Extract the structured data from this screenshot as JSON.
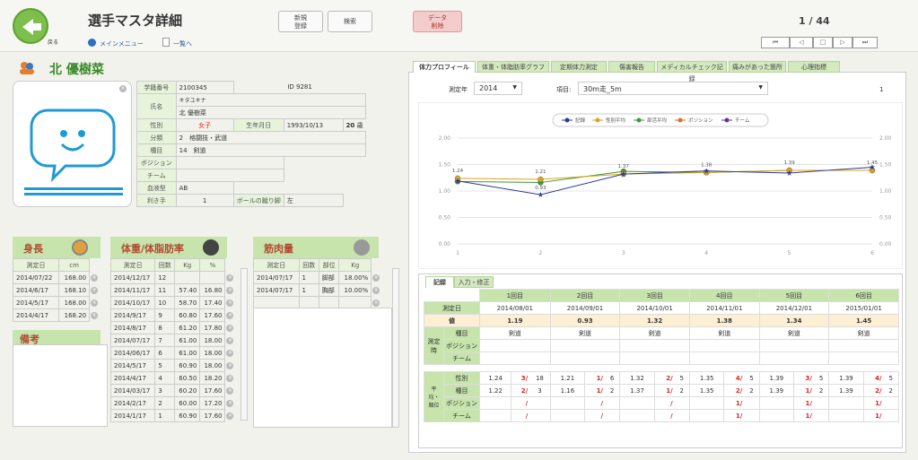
{
  "header": {
    "back_label": "戻る",
    "title": "選手マスタ詳細",
    "menu_link": "メインメニュー",
    "list_link": "一覧へ",
    "new_label": "新規\n登録",
    "search_label": "検索",
    "delete_label": "データ\n削除",
    "record_counter": "1 / 44"
  },
  "athlete": {
    "name": "北 優樹菜",
    "fields": {
      "student_no_label": "学籍番号",
      "student_no": "2100345",
      "id": "ID 9281",
      "name_label": "氏名",
      "kana": "キタユキナ",
      "name": "北 優樹菜",
      "gender_label": "性別",
      "gender": "女子",
      "birth_label": "生年月日",
      "birth": "1993/10/13",
      "age": "20",
      "age_unit": "歳",
      "class_label": "分類",
      "class_no": "2",
      "class_name": "格闘技・武道",
      "event_label": "種目",
      "event_no": "14",
      "event_name": "剣道",
      "position_label": "ポジション",
      "team_label": "チーム",
      "blood_label": "血液型",
      "blood": "AB",
      "hand_label": "利き手",
      "hand": "1",
      "foot_label": "ボールの蹴り脚",
      "foot": "左"
    }
  },
  "height": {
    "title": "身長",
    "col_date": "測定日",
    "col_unit": "cm",
    "rows": [
      [
        "2014/07/22",
        "168.00"
      ],
      [
        "2014/6/17",
        "168.10"
      ],
      [
        "2014/5/17",
        "168.00"
      ],
      [
        "2014/4/17",
        "168.20"
      ]
    ]
  },
  "weight": {
    "title": "体重/体脂肪率",
    "cols": [
      "測定日",
      "回数",
      "Kg",
      "%"
    ],
    "rows": [
      [
        "2014/12/17",
        "12",
        "",
        ""
      ],
      [
        "2014/11/17",
        "11",
        "57.40",
        "16.80"
      ],
      [
        "2014/10/17",
        "10",
        "58.70",
        "17.40"
      ],
      [
        "2014/9/17",
        "9",
        "60.80",
        "17.60"
      ],
      [
        "2014/8/17",
        "8",
        "61.20",
        "17.80"
      ],
      [
        "2014/07/17",
        "7",
        "61.00",
        "18.00"
      ],
      [
        "2014/06/17",
        "6",
        "61.00",
        "18.00"
      ],
      [
        "2014/5/17",
        "5",
        "60.90",
        "18.00"
      ],
      [
        "2014/4/17",
        "4",
        "60.50",
        "18.20"
      ],
      [
        "2014/03/17",
        "3",
        "60.20",
        "17.60"
      ],
      [
        "2014/2/17",
        "2",
        "60.00",
        "17.20"
      ],
      [
        "2014/1/17",
        "1",
        "60.90",
        "17.60"
      ]
    ]
  },
  "muscle": {
    "title": "筋肉量",
    "cols": [
      "測定日",
      "回数",
      "部位",
      "Kg"
    ],
    "rows": [
      [
        "2014/07/17",
        "1",
        "脚部",
        "18.00%"
      ],
      [
        "2014/07/17",
        "1",
        "胸部",
        "10.00%"
      ]
    ]
  },
  "notes": {
    "title": "備考"
  },
  "tabs": [
    "体力プロフィール",
    "体重・体脂肪率グラフ",
    "定期体力測定",
    "傷害報告",
    "メディカルチェック記録",
    "痛みがあった箇所",
    "心理指標"
  ],
  "filters": {
    "year_label": "測定年",
    "year": "2014",
    "item_label": "項目:",
    "item": "30m走_5m",
    "count": "1"
  },
  "chart_data": {
    "type": "line",
    "x": [
      1,
      2,
      3,
      4,
      5,
      6
    ],
    "ylim": [
      0,
      2
    ],
    "yticks": [
      "0.00",
      "0.50",
      "1.00",
      "1.50",
      "2.00"
    ],
    "legend": [
      "記録",
      "性別平均",
      "部活平均",
      "ポジション",
      "チーム"
    ],
    "legend_position": "top-center",
    "series": [
      {
        "name": "記録",
        "color": "#2d3b8f",
        "values": [
          1.19,
          0.93,
          1.32,
          1.38,
          1.34,
          1.45
        ]
      },
      {
        "name": "性別平均",
        "color": "#e0a020",
        "values": [
          1.24,
          1.22,
          1.32,
          1.35,
          1.39,
          1.39
        ]
      },
      {
        "name": "部活平均",
        "color": "#3a9a3a",
        "values": [
          1.18,
          1.16,
          1.37,
          1.35,
          1.39,
          1.39
        ]
      }
    ],
    "labels": [
      "1.24",
      "1.21",
      "1.37",
      "1.38",
      "1.39",
      "1.45"
    ]
  },
  "record_tabs": [
    "記録",
    "入力・修正"
  ],
  "grid": {
    "headers": [
      "1回目",
      "2回目",
      "3回目",
      "4回目",
      "5回目",
      "6回目"
    ],
    "date_label": "測定日",
    "dates": [
      "2014/08/01",
      "2014/09/01",
      "2014/10/01",
      "2014/11/01",
      "2014/12/01",
      "2015/01/01"
    ],
    "value_label": "値",
    "values": [
      "1.19",
      "0.93",
      "1.32",
      "1.38",
      "1.34",
      "1.45"
    ],
    "at_label": "測定時",
    "event_label": "種目",
    "pos_label": "ポジション",
    "team_label": "チーム",
    "events": [
      "剣道",
      "剣道",
      "剣道",
      "剣道",
      "剣道",
      "剣道"
    ],
    "rank_label": "平均・順位",
    "gender_label": "性別",
    "gender_rows": [
      [
        "1.24",
        "3/",
        "18"
      ],
      [
        "1.21",
        "1/",
        "6"
      ],
      [
        "1.32",
        "2/",
        "5"
      ],
      [
        "1.35",
        "4/",
        "5"
      ],
      [
        "1.39",
        "3/",
        "5"
      ],
      [
        "1.39",
        "4/",
        "5"
      ]
    ],
    "event_rows": [
      [
        "1.22",
        "2/",
        "3"
      ],
      [
        "1.16",
        "1/",
        "2"
      ],
      [
        "1.37",
        "1/",
        "2"
      ],
      [
        "1.35",
        "2/",
        "2"
      ],
      [
        "1.39",
        "1/",
        "2"
      ],
      [
        "1.39",
        "2/",
        "2"
      ]
    ],
    "pos_rows": [
      "/",
      "/",
      "/",
      "1/",
      "1/",
      "1/"
    ],
    "team_rows": [
      "/",
      "/",
      "/",
      "1/",
      "1/",
      "1/"
    ]
  }
}
